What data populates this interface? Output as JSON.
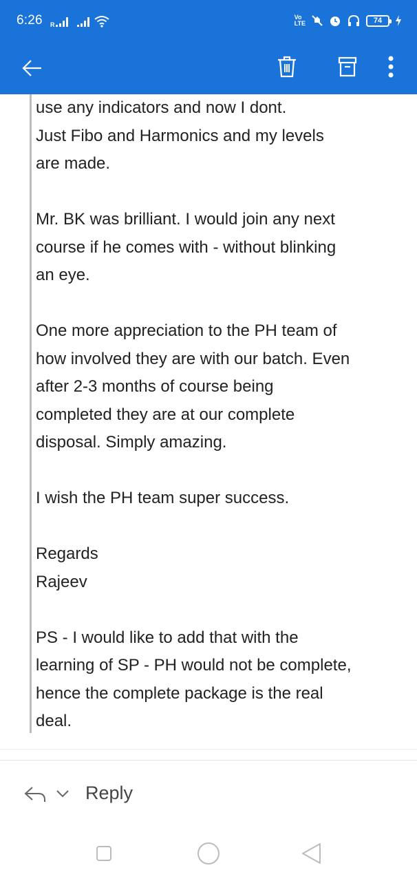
{
  "status_bar": {
    "time": "6:26",
    "volte": [
      "Vo",
      "LTE"
    ],
    "battery": "74"
  },
  "app_bar": {
    "back_icon": "arrow-left-icon",
    "delete_icon": "trash-icon",
    "archive_icon": "archive-icon",
    "more_icon": "more-vertical-icon",
    "color": "#1a73d9"
  },
  "message": {
    "paragraphs": [
      [
        "use any indicators and now I dont.",
        "Just Fibo and Harmonics and my levels",
        "are made."
      ],
      [
        "Mr. BK was brilliant. I would join any next",
        "course if he comes with - without blinking",
        "an eye."
      ],
      [
        "One more appreciation to the PH team of",
        "how involved they are with our batch. Even",
        "after 2-3 months of course being",
        "completed they are at our complete",
        "disposal. Simply amazing."
      ],
      [
        "I wish the PH team super success."
      ],
      [
        "Regards",
        "Rajeev"
      ],
      [
        "PS - I would like to add that with the",
        "learning of SP - PH would not be complete,",
        "hence the complete package is the real",
        "deal."
      ]
    ]
  },
  "reply_bar": {
    "reply_label": "Reply",
    "reply_icon": "reply-icon",
    "chevron_icon": "chevron-down-icon"
  },
  "nav_bar": {
    "recents_icon": "square-icon",
    "home_icon": "circle-icon",
    "back_icon": "triangle-back-icon"
  }
}
